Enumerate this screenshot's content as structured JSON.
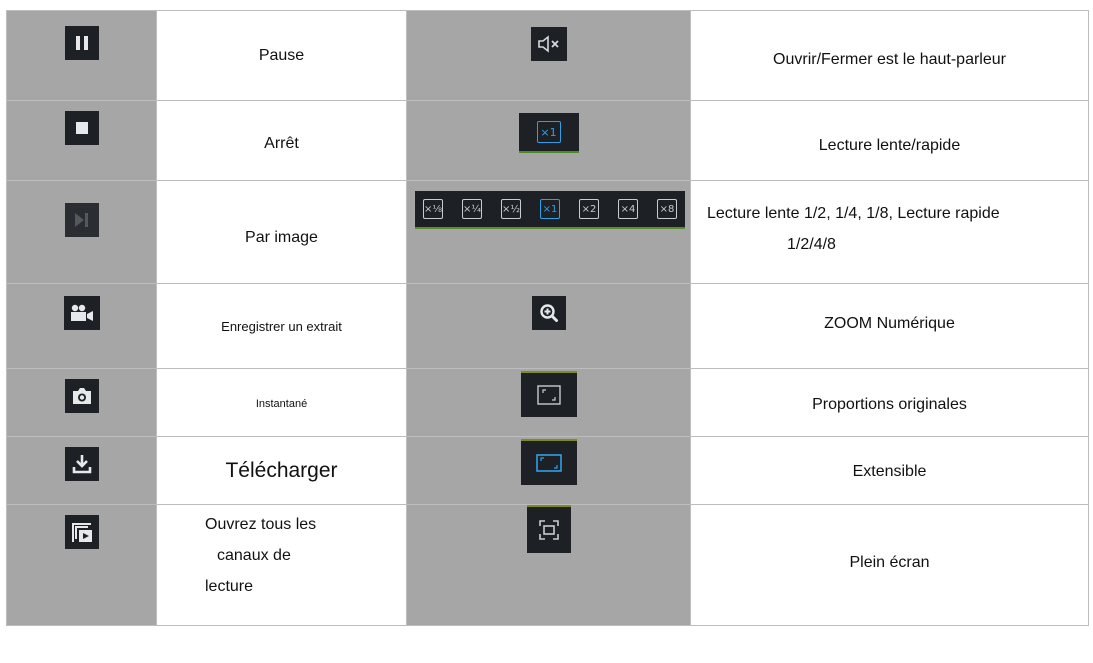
{
  "rows": [
    {
      "left_label": "Pause",
      "left_icon": "pause-icon",
      "right_label": "Ouvrir/Fermer est le haut-parleur",
      "right_icon": "speaker-mute-icon"
    },
    {
      "left_label": "Arrêt",
      "left_icon": "stop-icon",
      "right_label": "Lecture lente/rapide",
      "right_icon": "speed-x1-icon",
      "right_icon_text": "×1"
    },
    {
      "left_label": "Par image",
      "left_icon": "frame-step-icon",
      "right_label_lines": [
        "Lecture lente 1/2, 1/4, 1/8, Lecture rapide",
        "1/2/4/8"
      ],
      "right_icon": "speed-options-strip"
    },
    {
      "left_label": "Enregistrer un extrait",
      "left_icon": "video-clip-icon",
      "right_label": "ZOOM Numérique",
      "right_icon": "zoom-in-icon"
    },
    {
      "left_label": "Instantané",
      "left_icon": "camera-icon",
      "right_label": "Proportions originales",
      "right_icon": "original-ratio-icon"
    },
    {
      "left_label": "Télécharger",
      "left_icon": "download-icon",
      "right_label": "Extensible",
      "right_icon": "stretch-icon"
    },
    {
      "left_label_lines": [
        "Ouvrez tous les",
        "canaux de",
        "lecture"
      ],
      "left_icon": "open-all-channels-icon",
      "right_label": "Plein écran",
      "right_icon": "fullscreen-icon"
    }
  ],
  "speed_options": [
    {
      "text": "×⅛",
      "active": false
    },
    {
      "text": "×¼",
      "active": false
    },
    {
      "text": "×½",
      "active": false
    },
    {
      "text": "×1",
      "active": true
    },
    {
      "text": "×2",
      "active": false
    },
    {
      "text": "×4",
      "active": false
    },
    {
      "text": "×8",
      "active": false
    }
  ],
  "colors": {
    "cell_gray": "#a6a6a6",
    "icon_dark": "#1d2126",
    "icon_light": "#c8ccd1",
    "accent_blue": "#2fa0e6"
  }
}
